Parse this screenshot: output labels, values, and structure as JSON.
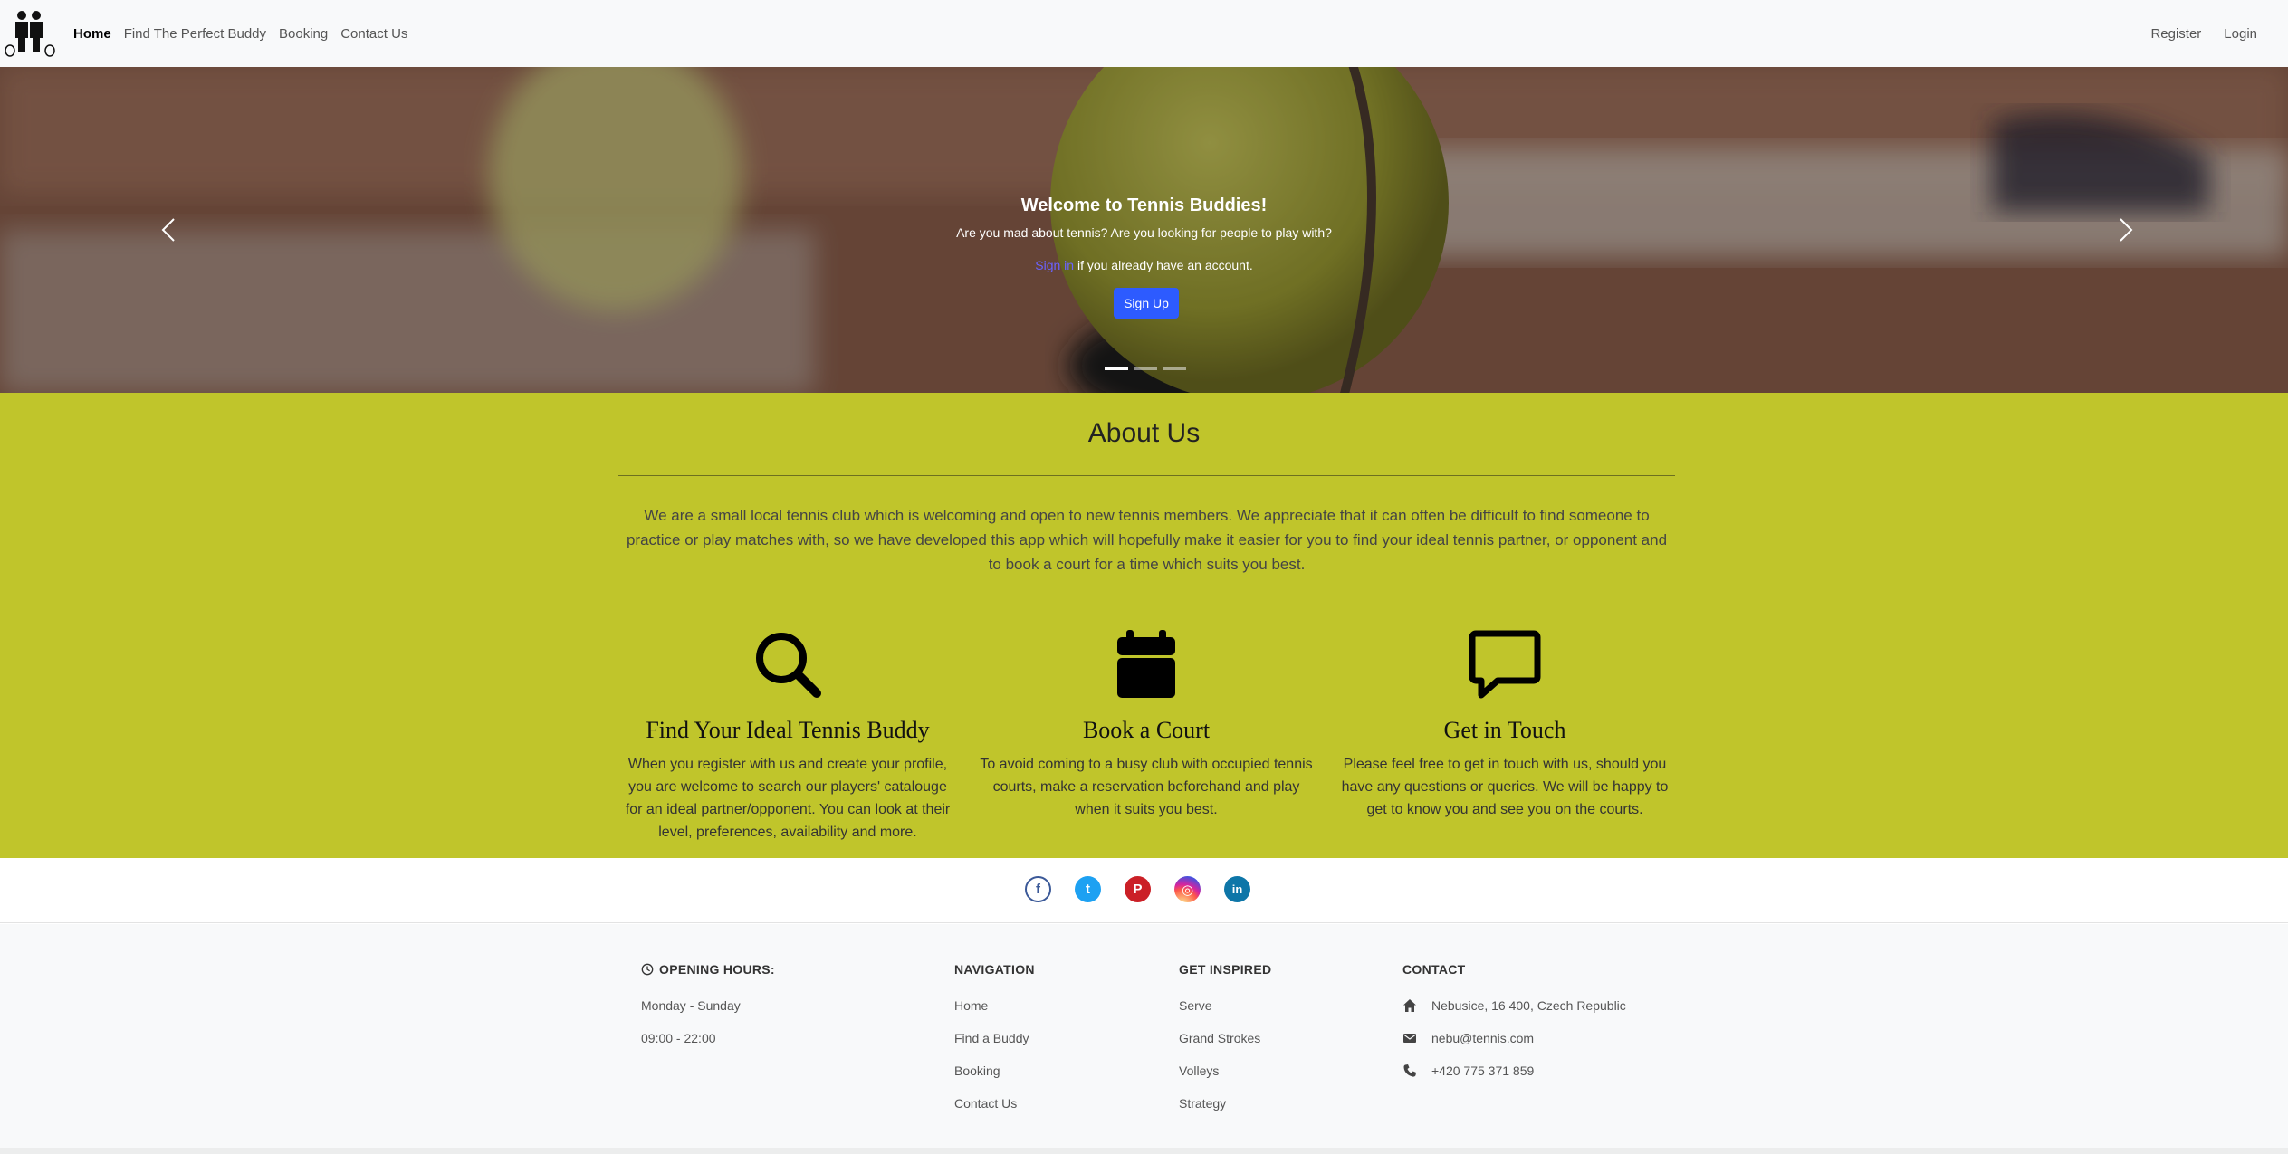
{
  "nav": {
    "home": "Home",
    "buddy": "Find The Perfect Buddy",
    "booking": "Booking",
    "contact": "Contact Us",
    "register": "Register",
    "login": "Login"
  },
  "hero": {
    "title": "Welcome to Tennis Buddies!",
    "subtitle": "Are you mad about tennis? Are you looking for people to play with?",
    "signin_link": "Sign in",
    "signin_rest": " if you already have an account.",
    "signup_button": "Sign Up",
    "active_slide": 1,
    "slide_count": 3
  },
  "about": {
    "title": "About Us",
    "text": "We are a small local tennis club which is welcoming and open to new tennis members. We appreciate that it can often be difficult to find someone to practice or play matches with, so we have developed this app which will hopefully make it easier for you to find your ideal tennis partner, or opponent and to book a court for a time which suits you best.",
    "features": [
      {
        "icon": "search-icon",
        "title": "Find Your Ideal Tennis Buddy",
        "text": "When you register with us and create your profile, you are welcome to search our players' catalouge for an ideal partner/opponent. You can look at their level, preferences, availability and more."
      },
      {
        "icon": "calendar-icon",
        "title": "Book a Court",
        "text": "To avoid coming to a busy club with occupied tennis courts, make a reservation beforehand and play when it suits you best."
      },
      {
        "icon": "chat-icon",
        "title": "Get in Touch",
        "text": "Please feel free to get in touch with us, should you have any questions or queries. We will be happy to get to know you and see you on the courts."
      }
    ]
  },
  "social": {
    "facebook": "f",
    "twitter": "t",
    "pinterest": "P",
    "instagram": "◎",
    "linkedin": "in"
  },
  "footer": {
    "hours": {
      "heading": "OPENING HOURS:",
      "days": "Monday - Sunday",
      "times": "09:00 - 22:00"
    },
    "navigation": {
      "heading": "NAVIGATION",
      "items": [
        "Home",
        "Find a Buddy",
        "Booking",
        "Contact Us"
      ]
    },
    "inspired": {
      "heading": "GET INSPIRED",
      "items": [
        "Serve",
        "Grand Strokes",
        "Volleys",
        "Strategy"
      ]
    },
    "contact": {
      "heading": "CONTACT",
      "address": "Nebusice, 16 400, Czech Republic",
      "email": "nebu@tennis.com",
      "phone": "+420 775 371 859"
    }
  },
  "colors": {
    "about_bg": "#c0c52b",
    "signup_btn": "#2d5bff",
    "navbar_bg": "#f8f9fa"
  }
}
